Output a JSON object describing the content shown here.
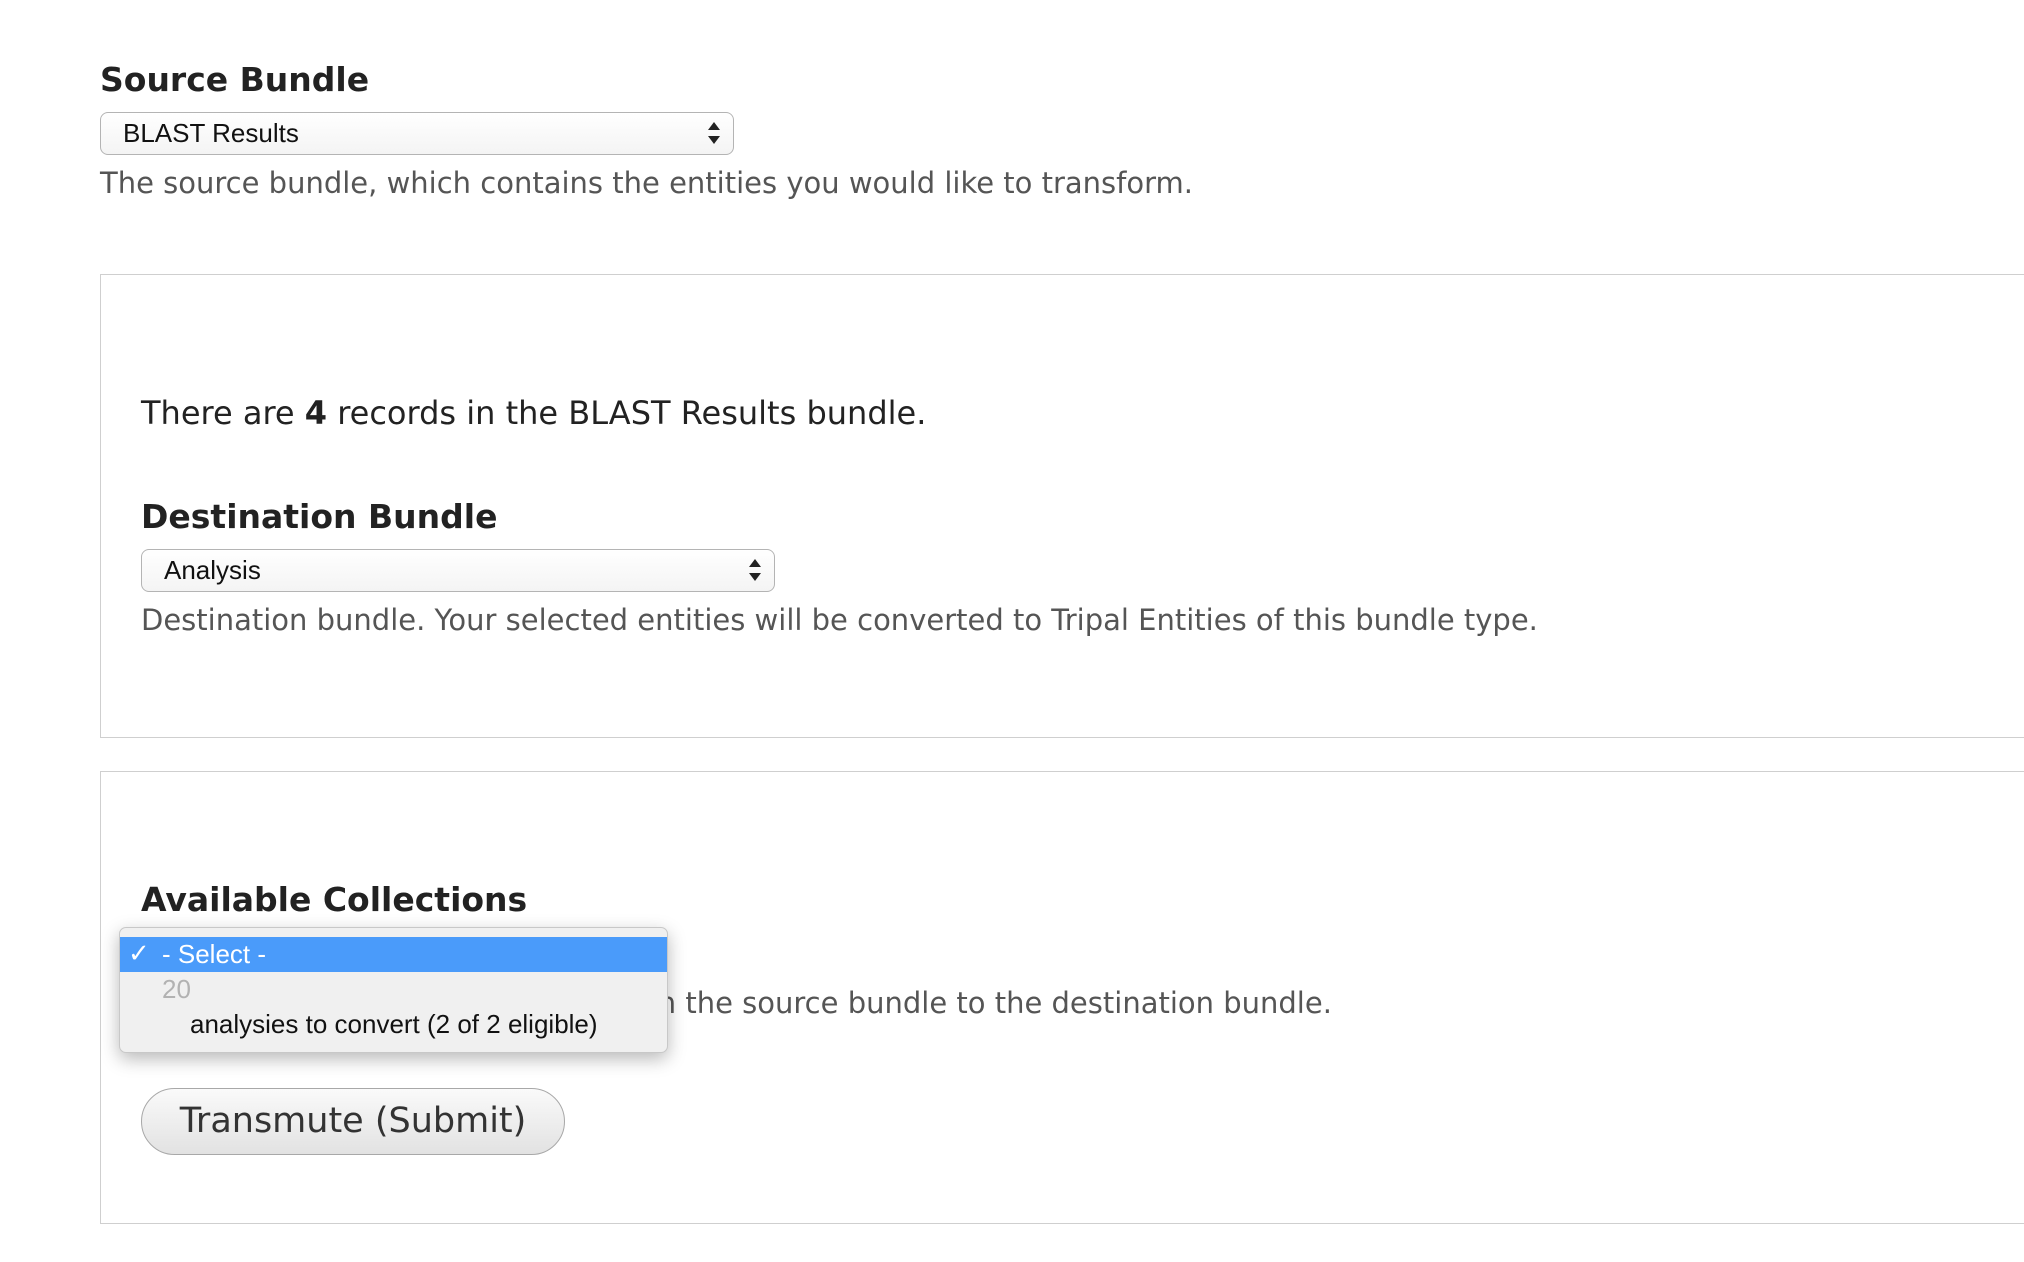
{
  "source": {
    "label": "Source Bundle",
    "selected": "BLAST Results",
    "description": "The source bundle, which contains the entities you would like to transform."
  },
  "records": {
    "prefix": "There are ",
    "count": "4",
    "suffix": " records in the BLAST Results bundle."
  },
  "destination": {
    "label": "Destination Bundle",
    "selected": "Analysis",
    "description": "Destination bundle. Your selected entities will be converted to Tripal Entities of this bundle type."
  },
  "collections": {
    "label": "Available Collections",
    "description_visible": "ll eligible entities in a collection form the source bundle to the destination bundle.",
    "dropdown": {
      "check": "✓",
      "selected_option": "- Select -",
      "group_label": "20",
      "option": "analysies to convert (2 of 2 eligible)"
    }
  },
  "submit": {
    "label": "Transmute (Submit)"
  },
  "colors": {
    "highlight": "#4a9bfa",
    "border": "#cfcfcf",
    "text": "#333333"
  }
}
